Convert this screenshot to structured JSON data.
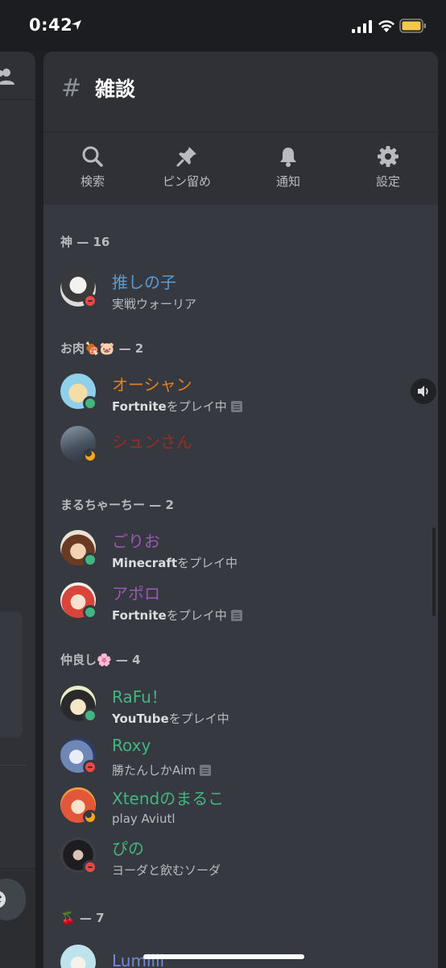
{
  "status_bar": {
    "time": "0:42"
  },
  "channel": {
    "name": "雑談"
  },
  "actions": [
    {
      "label": "検索",
      "icon": "search-icon"
    },
    {
      "label": "ピン留め",
      "icon": "pin-icon"
    },
    {
      "label": "通知",
      "icon": "bell-icon"
    },
    {
      "label": "設定",
      "icon": "gear-icon"
    }
  ],
  "groups": [
    {
      "header": "神 — 16",
      "members": [
        {
          "name": "推しの子",
          "color": "#5b9bd5",
          "status": "dnd",
          "activity_prefix": "",
          "activity": "実戦ウォーリア",
          "rich": false,
          "avatar_color": "#c9c9c9"
        }
      ]
    },
    {
      "header": "お肉🍖🐷 — 2",
      "members": [
        {
          "name": "オーシャン",
          "color": "#e67e22",
          "status": "online",
          "activity_prefix": "Fortnite",
          "activity": "をプレイ中",
          "rich": true,
          "voice": true,
          "avatar_color": "#9fd3e8"
        },
        {
          "name": "シュンさん",
          "color": "#992d22",
          "status": "idle",
          "activity_prefix": "",
          "activity": "",
          "rich": false,
          "avatar_color": "#5a6470"
        }
      ]
    },
    {
      "header": "まるちゃーちー — 2",
      "members": [
        {
          "name": "ごりお",
          "color": "#9b59b6",
          "status": "online",
          "activity_prefix": "Minecraft",
          "activity": "をプレイ中",
          "rich": false,
          "avatar_color": "#7a4a2a"
        },
        {
          "name": "アポロ",
          "color": "#9b59b6",
          "status": "online",
          "activity_prefix": "Fortnite",
          "activity": "をプレイ中",
          "rich": true,
          "avatar_color": "#d9534f"
        }
      ]
    },
    {
      "header": "仲良し🌸 — 4",
      "members": [
        {
          "name": "RaFu！",
          "color": "#43b581",
          "status": "online",
          "activity_prefix": "YouTube",
          "activity": "をプレイ中",
          "rich": false,
          "avatar_color": "#3b3b3b"
        },
        {
          "name": "Roxy",
          "color": "#43b581",
          "status": "dnd",
          "activity_prefix": "",
          "activity": "勝たんしかAim",
          "rich": true,
          "avatar_color": "#6f87b5"
        },
        {
          "name": "Xtendのまるこ",
          "color": "#43b581",
          "status": "idle",
          "activity_prefix": "",
          "activity": "play Aviutl",
          "rich": false,
          "avatar_color": "#e2573a"
        },
        {
          "name": "ぴの",
          "color": "#43b581",
          "status": "dnd",
          "activity_prefix": "",
          "activity": "ヨーダと飲むソーダ",
          "rich": false,
          "avatar_color": "#2b2b2e"
        }
      ]
    },
    {
      "header": "🍒 — 7",
      "members": [
        {
          "name": "Lumiiii",
          "color": "#7289da",
          "status": "online",
          "activity_prefix": "",
          "activity": "",
          "rich": false,
          "avatar_color": "#cfe6ee"
        }
      ]
    }
  ]
}
